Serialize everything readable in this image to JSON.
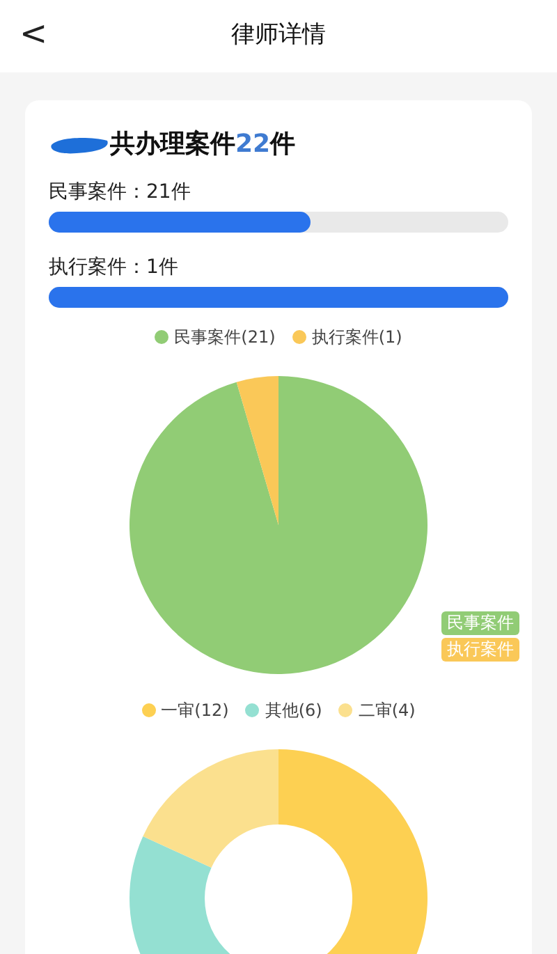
{
  "header": {
    "back": "<",
    "title": "律师详情"
  },
  "summary": {
    "prefix": "共办理案件",
    "count": "22",
    "suffix": "件"
  },
  "case_bars": [
    {
      "label": "民事案件：21件",
      "level": 0.57
    },
    {
      "label": "执行案件：1件",
      "level": 1
    }
  ],
  "type_chart": {
    "chart_data": {
      "type": "pie",
      "categories": [
        "民事案件(21)",
        "执行案件(1)"
      ],
      "values": [
        21,
        1
      ],
      "legend": "top",
      "colors": [
        "#91cc75",
        "#fac858"
      ]
    },
    "tags": [
      {
        "label": "民事案件",
        "color": "#91cc75"
      },
      {
        "label": "执行案件",
        "color": "#fac858"
      }
    ]
  },
  "stage_chart": {
    "chart_data": {
      "type": "donut",
      "categories": [
        "一审(12)",
        "其他(6)",
        "二审(4)"
      ],
      "values": [
        12,
        6,
        4
      ],
      "legend": "top",
      "colors": [
        "#fdd052",
        "#94e0d2",
        "#fbe08e"
      ]
    }
  }
}
